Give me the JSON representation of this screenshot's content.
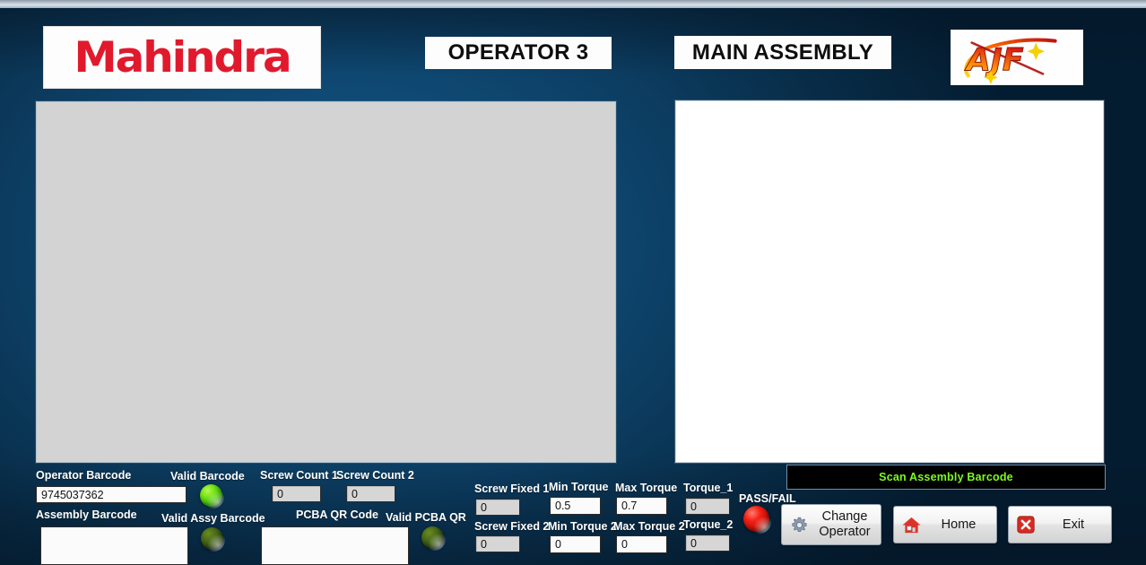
{
  "header": {
    "brand_logo": "mahindra-logo",
    "brand_text": "Mahindra",
    "operator_title": "OPERATOR 3",
    "station_title": "MAIN ASSEMBLY",
    "vendor_logo": "ajf-logo",
    "vendor_text": "AJF"
  },
  "panels": {
    "camera_view_name": "camera-image-panel",
    "log_view_name": "assembly-log-panel"
  },
  "barcodes": {
    "operator_label": "Operator Barcode",
    "operator_value": "9745037362",
    "operator_valid_label": "Valid Barcode",
    "operator_valid_state": "on",
    "assembly_label": "Assembly Barcode",
    "assembly_value": "",
    "assembly_valid_label": "Valid Assy Barcode",
    "assembly_valid_state": "off",
    "pcba_label": "PCBA QR Code",
    "pcba_value": "",
    "pcba_valid_label": "Valid PCBA QR",
    "pcba_valid_state": "off"
  },
  "counters": {
    "screw_count_1_label": "Screw Count 1",
    "screw_count_1_value": "0",
    "screw_count_2_label": "Screw Count 2",
    "screw_count_2_value": "0"
  },
  "torque": {
    "screw_fixed_1_label": "Screw Fixed 1",
    "screw_fixed_1_value": "0",
    "min_torque_1_label": "Min Torque",
    "min_torque_1_value": "0.5",
    "max_torque_1_label": "Max Torque",
    "max_torque_1_value": "0.7",
    "torque_1_label": "Torque_1",
    "torque_1_value": "0",
    "screw_fixed_2_label": "Screw Fixed 2",
    "screw_fixed_2_value": "0",
    "min_torque_2_label": "Min Torque 2",
    "min_torque_2_value": "0",
    "max_torque_2_label": "Max Torque 2",
    "max_torque_2_value": "0",
    "torque_2_label": "Torque_2",
    "torque_2_value": "0"
  },
  "result": {
    "pass_fail_label": "PASS/FAIL",
    "pass_fail_state": "fail"
  },
  "status": {
    "message": "Scan Assembly Barcode",
    "text_color": "#7dfa1e",
    "background_color": "#000000"
  },
  "buttons": {
    "change_operator": "Change Operator",
    "change_operator_line1": "Change",
    "change_operator_line2": "Operator",
    "home": "Home",
    "exit": "Exit"
  },
  "colors": {
    "background_blue": "#0f4b76",
    "brand_red": "#e1192d",
    "led_green_on": "#74e216",
    "led_green_off": "#49691a",
    "led_red_on": "#f32014"
  }
}
